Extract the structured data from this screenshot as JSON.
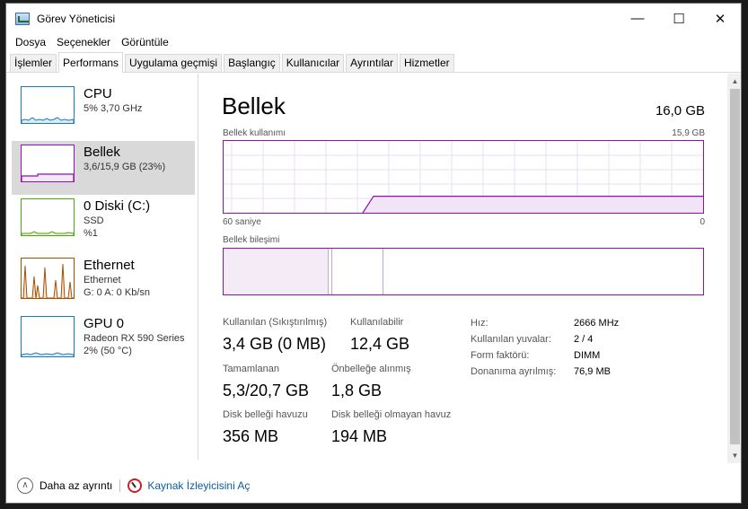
{
  "window": {
    "title": "Görev Yöneticisi"
  },
  "controls": {
    "minimize": "—",
    "maximize": "☐",
    "close": "✕"
  },
  "menu": [
    "Dosya",
    "Seçenekler",
    "Görüntüle"
  ],
  "tabs": [
    "İşlemler",
    "Performans",
    "Uygulama geçmişi",
    "Başlangıç",
    "Kullanıcılar",
    "Ayrıntılar",
    "Hizmetler"
  ],
  "sidebar": [
    {
      "name": "CPU",
      "sub1": "5% 3,70 GHz",
      "sub2": "",
      "sub3": "",
      "color": "#1c7ab8"
    },
    {
      "name": "Bellek",
      "sub1": "3,6/15,9 GB (23%)",
      "sub2": "",
      "sub3": "",
      "color": "#8b12ae"
    },
    {
      "name": "0 Diski (C:)",
      "sub1": "SSD",
      "sub2": "%1",
      "sub3": "",
      "color": "#4da60c"
    },
    {
      "name": "Ethernet",
      "sub1": "Ethernet",
      "sub2": "G: 0 A: 0 Kb/sn",
      "sub3": "",
      "color": "#a74f01"
    },
    {
      "name": "GPU 0",
      "sub1": "Radeon RX 590 Series",
      "sub2": "2% (50 °C)",
      "sub3": "",
      "color": "#1c7ab8"
    }
  ],
  "main": {
    "title": "Bellek",
    "total": "16,0 GB",
    "usage_label": "Bellek kullanımı",
    "usage_max": "15,9 GB",
    "time_left": "60 saniye",
    "time_right": "0",
    "composition_label": "Bellek bileşimi",
    "usage_level": 0.23
  },
  "stats": {
    "in_use_label": "Kullanılan (Sıkıştırılmış)",
    "in_use": "3,4 GB (0 MB)",
    "available_label": "Kullanılabilir",
    "available": "12,4 GB",
    "committed_label": "Tamamlanan",
    "committed": "5,3/20,7 GB",
    "cached_label": "Önbelleğe alınmış",
    "cached": "1,8 GB",
    "paged_label": "Disk belleği havuzu",
    "paged": "356 MB",
    "nonpaged_label": "Disk belleği olmayan havuz",
    "nonpaged": "194 MB"
  },
  "specs": [
    {
      "k": "Hız:",
      "v": "2666 MHz"
    },
    {
      "k": "Kullanılan yuvalar:",
      "v": "2 / 4"
    },
    {
      "k": "Form faktörü:",
      "v": "DIMM"
    },
    {
      "k": "Donanıma ayrılmış:",
      "v": "76,9 MB"
    }
  ],
  "footer": {
    "less": "Daha az ayrıntı",
    "monitor": "Kaynak İzleyicisini Aç"
  }
}
